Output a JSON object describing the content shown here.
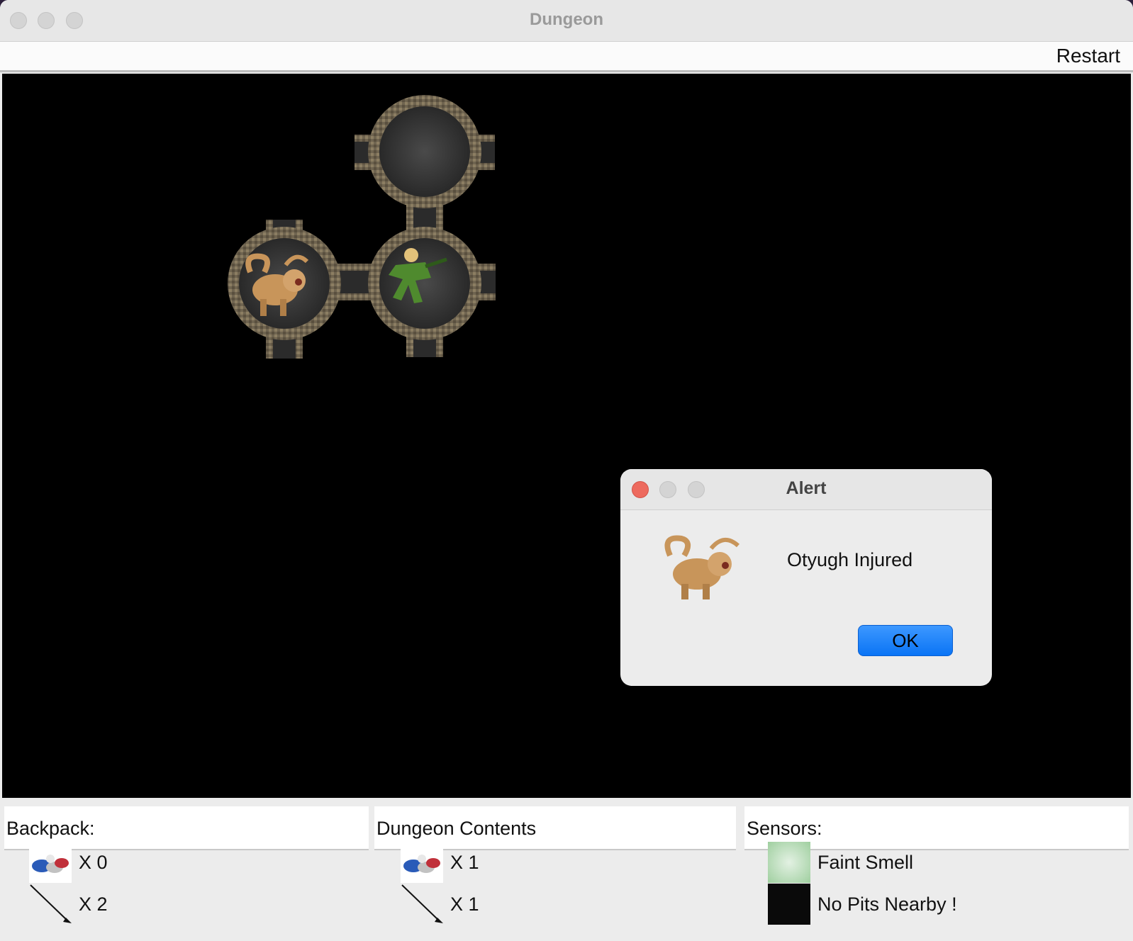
{
  "window": {
    "title": "Dungeon"
  },
  "menu": {
    "restart_label": "Restart"
  },
  "panels": {
    "backpack": {
      "header": "Backpack:",
      "treasure_qty": "X  0",
      "arrow_qty": "X 2"
    },
    "dungeon_contents": {
      "header": "Dungeon Contents",
      "treasure_qty": "X 1",
      "arrow_qty": "X 1"
    },
    "sensors": {
      "header": "Sensors:",
      "smell_text": "Faint Smell",
      "pit_text": "No Pits Nearby !"
    }
  },
  "dialog": {
    "title": "Alert",
    "message": "Otyugh Injured",
    "ok_label": "OK"
  },
  "colors": {
    "ok_button": "#0a74f5",
    "close_red": "#ed6a5e"
  },
  "icons": {
    "treasure": "treasure-icon",
    "arrow": "arrow-icon",
    "smell": "smell-icon",
    "pit": "pit-icon",
    "otyugh": "otyugh-icon",
    "player": "player-icon"
  }
}
